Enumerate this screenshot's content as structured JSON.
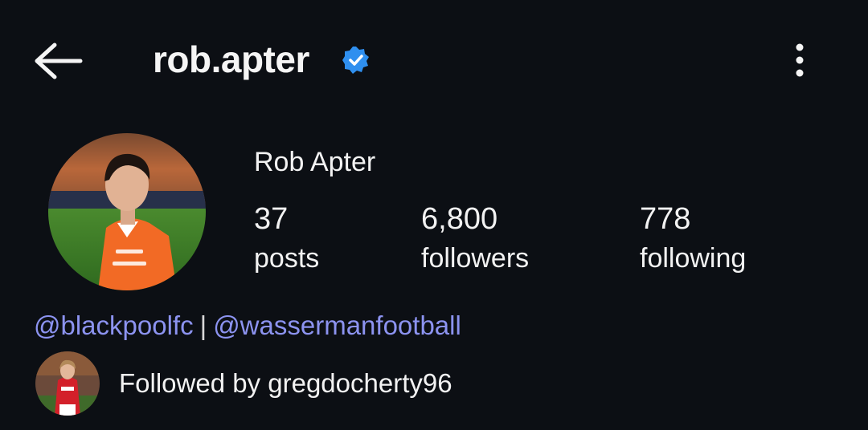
{
  "header": {
    "username": "rob.apter",
    "verified": true,
    "back_icon": "arrow-left-icon",
    "more_icon": "more-vertical-icon"
  },
  "profile": {
    "display_name": "Rob Apter",
    "stats": [
      {
        "value": "37",
        "label": "posts"
      },
      {
        "value": "6,800",
        "label": "followers"
      },
      {
        "value": "778",
        "label": "following"
      }
    ],
    "bio_links": [
      "@blackpoolfc",
      "@wassermanfootball"
    ],
    "bio_separator": "|",
    "followed_by": "Followed by gregdocherty96"
  },
  "colors": {
    "background": "#0c0f14",
    "text": "#f5f5f5",
    "link": "#8c93f0",
    "verified": "#2f8fef",
    "kit_orange": "#f26a25"
  }
}
